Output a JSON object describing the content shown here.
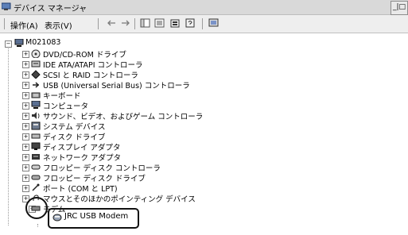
{
  "window": {
    "title": "デバイス マネージャ",
    "control_label": "_|□"
  },
  "menu": {
    "action": "操作(A)",
    "view": "表示(V)"
  },
  "tree": {
    "root": "M021083",
    "items": [
      {
        "label": "DVD/CD-ROM ドライブ",
        "icon": "dvd-icon"
      },
      {
        "label": "IDE ATA/ATAPI コントローラ",
        "icon": "ide-icon"
      },
      {
        "label": "SCSI と RAID コントローラ",
        "icon": "scsi-icon"
      },
      {
        "label": "USB (Universal Serial Bus) コントローラ",
        "icon": "usb-icon"
      },
      {
        "label": "キーボード",
        "icon": "keyboard-icon"
      },
      {
        "label": "コンピュータ",
        "icon": "computer-icon"
      },
      {
        "label": "サウンド、ビデオ、およびゲーム コントローラ",
        "icon": "sound-icon"
      },
      {
        "label": "システム デバイス",
        "icon": "system-icon"
      },
      {
        "label": "ディスク ドライブ",
        "icon": "disk-icon"
      },
      {
        "label": "ディスプレイ アダプタ",
        "icon": "display-icon"
      },
      {
        "label": "ネットワーク アダプタ",
        "icon": "network-icon"
      },
      {
        "label": "フロッピー ディスク コントローラ",
        "icon": "floppy-controller-icon"
      },
      {
        "label": "フロッピー ディスク ドライブ",
        "icon": "floppy-drive-icon"
      },
      {
        "label": "ポート (COM と LPT)",
        "icon": "port-icon"
      },
      {
        "label": "マウスとそのほかのポインティング デバイス",
        "icon": "mouse-icon"
      },
      {
        "label": "モデム",
        "icon": "modem-icon"
      }
    ],
    "modem_child": "JRC USB Modem"
  }
}
